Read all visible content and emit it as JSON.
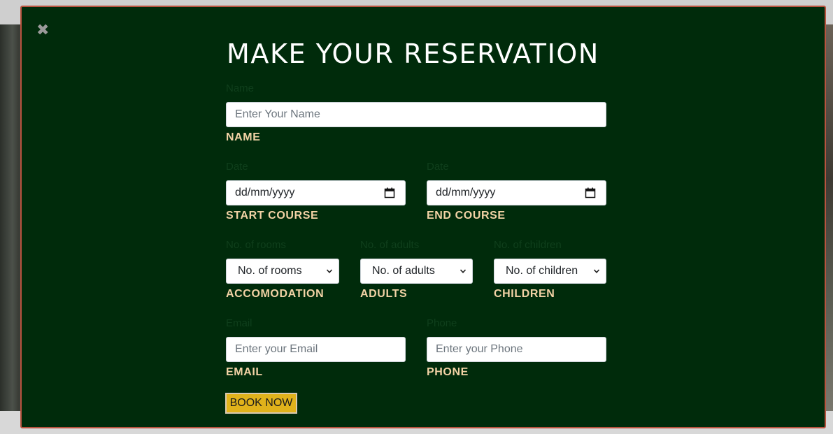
{
  "close_icon": "close-icon",
  "form": {
    "title": "MAKE YOUR RESERVATION",
    "name": {
      "ghost_label": "Name",
      "placeholder": "Enter Your Name",
      "label": "NAME"
    },
    "start_date": {
      "ghost_label": "Date",
      "value": "dd/mm/yyyy",
      "label": "START COURSE",
      "icon": "calendar-icon"
    },
    "end_date": {
      "ghost_label": "Date",
      "value": "dd/mm/yyyy",
      "label": "END COURSE",
      "icon": "calendar-icon"
    },
    "rooms": {
      "ghost_label": "No. of rooms",
      "selected": "No. of rooms",
      "label": "ACCOMODATION"
    },
    "adults": {
      "ghost_label": "No. of adults",
      "selected": "No. of adults",
      "label": "ADULTS"
    },
    "children": {
      "ghost_label": "No. of children",
      "selected": "No. of children",
      "label": "CHILDREN"
    },
    "email": {
      "ghost_label": "Email",
      "placeholder": "Enter your Email",
      "label": "EMAIL"
    },
    "phone": {
      "ghost_label": "Phone",
      "placeholder": "Enter your Phone",
      "label": "PHONE"
    },
    "submit_label": "BOOK NOW"
  },
  "colors": {
    "modal_bg": "#002b0b",
    "modal_border": "#b8533f",
    "label": "#f3d3a6",
    "button": "#e0b21b"
  }
}
